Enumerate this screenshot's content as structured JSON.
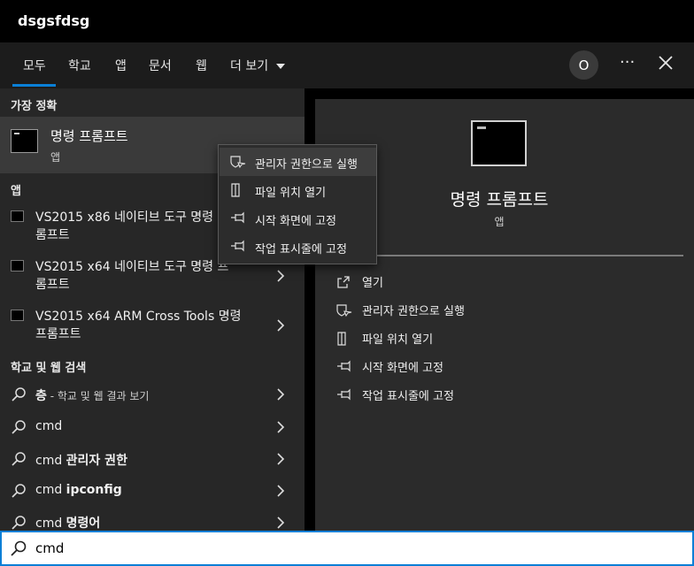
{
  "window": {
    "title": "dsgsfdsg"
  },
  "tabs": [
    {
      "label": "모두",
      "active": true
    },
    {
      "label": "학교"
    },
    {
      "label": "앱"
    },
    {
      "label": "문서"
    },
    {
      "label": "웹"
    },
    {
      "label": "더 보기"
    }
  ],
  "header": {
    "avatar_letter": "O",
    "more_label": "···"
  },
  "left": {
    "best_match_header": "가장 정확",
    "best_match": {
      "title": "명령 프롬프트",
      "subtitle": "앱"
    },
    "apps_header": "앱",
    "apps": [
      {
        "line1": "VS2015 x86 네이티브 도구 명령",
        "line2": "롬프트"
      },
      {
        "line1": "VS2015 x64 네이티브 도구 명령 프",
        "line2": "롬프트"
      },
      {
        "line1": "VS2015 x64 ARM Cross Tools 명령",
        "line2": "프롬프트"
      }
    ],
    "web_header": "학교 및 웹 검색",
    "web_results": [
      {
        "prefix": "",
        "bold": "층",
        "sub": " - 학교 및 웹 결과 보기"
      },
      {
        "prefix": "cmd",
        "bold": "",
        "sub": ""
      },
      {
        "prefix": "cmd ",
        "bold": "관리자 권한",
        "sub": ""
      },
      {
        "prefix": "cmd ",
        "bold": "ipconfig",
        "sub": ""
      },
      {
        "prefix": "cmd ",
        "bold": "명령어",
        "sub": ""
      }
    ]
  },
  "context_menu": [
    {
      "label": "관리자 권한으로 실행",
      "icon": "shield-icon"
    },
    {
      "label": "파일 위치 열기",
      "icon": "file-location-icon"
    },
    {
      "label": "시작 화면에 고정",
      "icon": "pin-icon"
    },
    {
      "label": "작업 표시줄에 고정",
      "icon": "pin-icon"
    }
  ],
  "right": {
    "title": "명령 프롬프트",
    "subtitle": "앱",
    "actions": [
      {
        "label": "열기",
        "icon": "open-icon"
      },
      {
        "label": "관리자 권한으로 실행",
        "icon": "shield-icon"
      },
      {
        "label": "파일 위치 열기",
        "icon": "file-location-icon"
      },
      {
        "label": "시작 화면에 고정",
        "icon": "pin-icon"
      },
      {
        "label": "작업 표시줄에 고정",
        "icon": "pin-icon"
      }
    ]
  },
  "search": {
    "value": "cmd"
  },
  "colors": {
    "accent": "#0a7fd6",
    "panel": "#272727",
    "detail_panel": "#2b2b2b"
  }
}
